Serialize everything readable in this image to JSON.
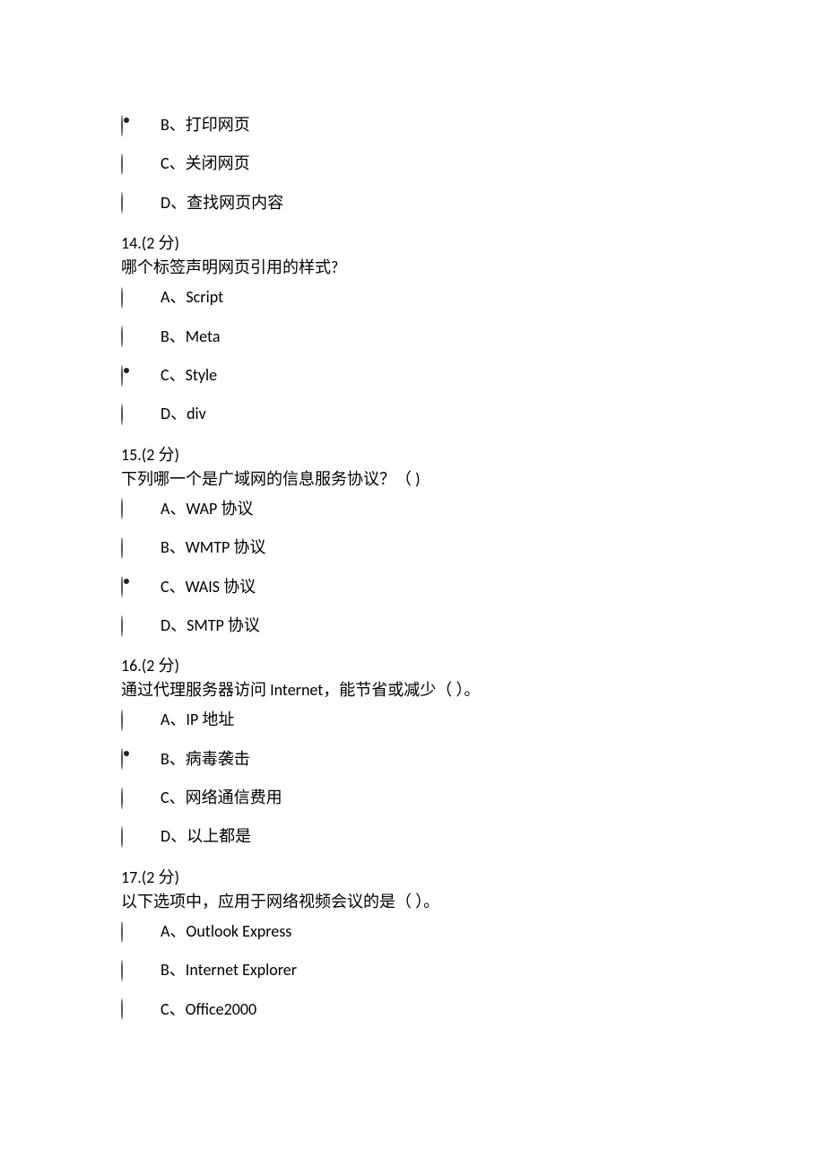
{
  "q13_tail": {
    "options": [
      {
        "label": "B、打印网页",
        "selected": true
      },
      {
        "label": "C、关闭网页",
        "selected": false
      },
      {
        "label": "D、查找网页内容",
        "selected": false
      }
    ]
  },
  "q14": {
    "number_points": "14.(2 分)",
    "stem": "哪个标签声明网页引用的样式?",
    "options": [
      {
        "label": "A、Script",
        "selected": false
      },
      {
        "label": "B、Meta",
        "selected": false
      },
      {
        "label": "C、Style",
        "selected": true
      },
      {
        "label": "D、div",
        "selected": false
      }
    ]
  },
  "q15": {
    "number_points": "15.(2 分)",
    "stem": "下列哪一个是广域网的信息服务协议？（  )",
    "options": [
      {
        "label": "A、WAP 协议",
        "selected": false
      },
      {
        "label": "B、WMTP 协议",
        "selected": false
      },
      {
        "label": "C、WAIS 协议",
        "selected": true
      },
      {
        "label": "D、SMTP 协议",
        "selected": false
      }
    ]
  },
  "q16": {
    "number_points": "16.(2 分)",
    "stem": "通过代理服务器访问 Internet，能节省或减少（ ）。",
    "options": [
      {
        "label": "A、IP 地址",
        "selected": false
      },
      {
        "label": "B、病毒袭击",
        "selected": true
      },
      {
        "label": "C、网络通信费用",
        "selected": false
      },
      {
        "label": "D、以上都是",
        "selected": false
      }
    ]
  },
  "q17": {
    "number_points": "17.(2 分)",
    "stem": "以下选项中，应用于网络视频会议的是（ ）。",
    "options": [
      {
        "label": "A、Outlook Express",
        "selected": false
      },
      {
        "label": "B、Internet Explorer",
        "selected": false
      },
      {
        "label": "C、Office2000",
        "selected": false
      }
    ]
  }
}
